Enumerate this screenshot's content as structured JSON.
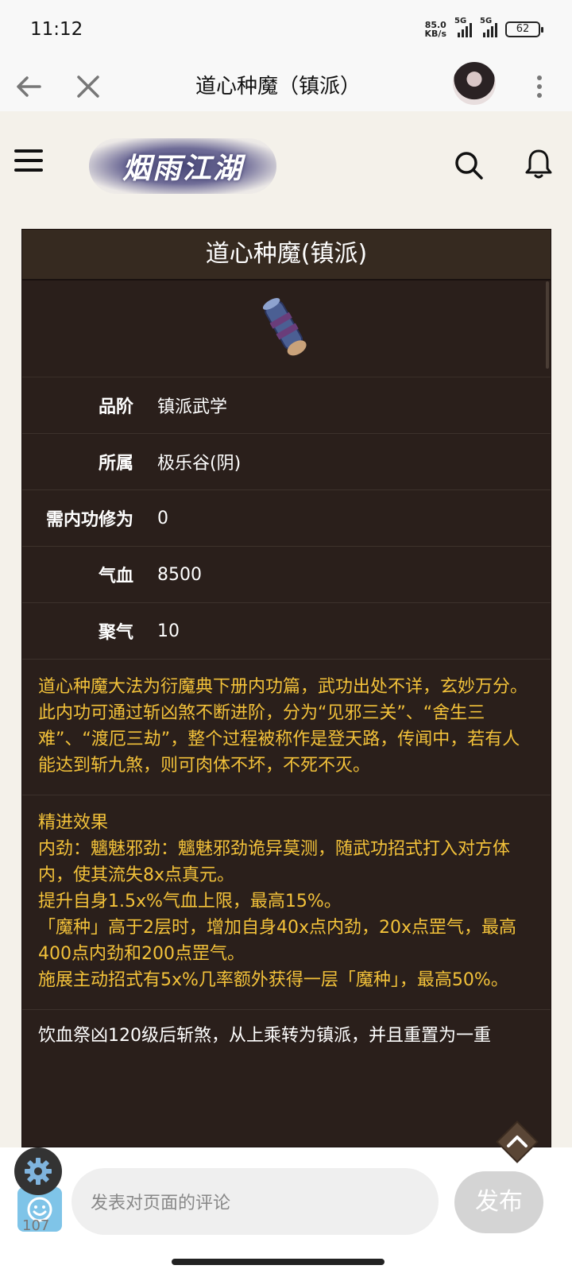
{
  "status_bar": {
    "time": "11:12",
    "net_speed_value": "85.0",
    "net_speed_unit": "KB/s",
    "signal_1_label": "5G",
    "signal_2_label": "5G",
    "battery": "62"
  },
  "app_bar": {
    "title": "道心种魔（镇派）"
  },
  "site": {
    "logo_text": "烟雨江湖"
  },
  "card": {
    "title": "道心种魔(镇派)",
    "rows": [
      {
        "key": "品阶",
        "value": "镇派武学"
      },
      {
        "key": "所属",
        "value": "极乐谷(阴)"
      },
      {
        "key": "需内功修为",
        "value": "0"
      },
      {
        "key": "气血",
        "value": "8500"
      },
      {
        "key": "聚气",
        "value": "10"
      }
    ],
    "description": "道心种魔大法为衍魔典下册内功篇，武功出处不详，玄妙万分。此内功可通过斩凶煞不断进阶，分为“见邪三关”、“舍生三难”、“渡厄三劫”，整个过程被称作是登天路，传闻中，若有人能达到斩九煞，则可肉体不坏，不死不灭。",
    "effects": [
      "精进效果",
      "内劲：魑魅邪劲：魑魅邪劲诡异莫测，随武功招式打入对方体内，使其流失8x点真元。",
      "提升自身1.5x%气血上限，最高15%。",
      "「魔种」高于2层时，增加自身40x点内劲，20x点罡气，最高400点内劲和200点罡气。",
      "施展主动招式有5x%几率额外获得一层「魔种」，最高50%。"
    ],
    "note": "饮血祭凶120级后斩煞，从上乘转为镇派，并且重置为一重"
  },
  "bottom": {
    "emoji_count": "107",
    "comment_placeholder": "发表对页面的评论",
    "publish_label": "发布"
  },
  "colors": {
    "card_bg": "#2a1f1b",
    "desc_text": "#f3c23a",
    "page_bg": "#f4f1ea"
  }
}
